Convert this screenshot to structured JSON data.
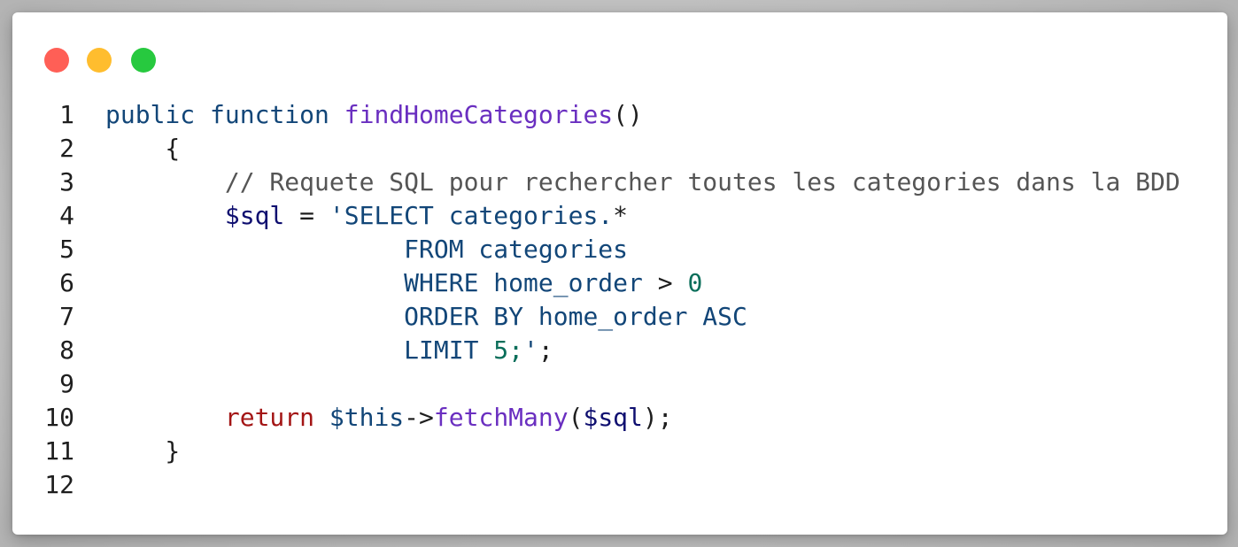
{
  "window": {
    "controls": {
      "close_color": "#ff5f56",
      "minimize_color": "#ffbd2e",
      "maximize_color": "#27c93f"
    }
  },
  "code": {
    "line_numbers": [
      "1",
      "2",
      "3",
      "4",
      "5",
      "6",
      "7",
      "8",
      "9",
      "10",
      "11",
      "12"
    ],
    "lines": [
      {
        "tokens": [
          {
            "t": "public",
            "c": "kw"
          },
          {
            "t": " ",
            "c": "op"
          },
          {
            "t": "function",
            "c": "kw"
          },
          {
            "t": " ",
            "c": "op"
          },
          {
            "t": "findHomeCategories",
            "c": "fn"
          },
          {
            "t": "()",
            "c": "op"
          }
        ]
      },
      {
        "tokens": [
          {
            "t": "    {",
            "c": "op"
          }
        ]
      },
      {
        "tokens": [
          {
            "t": "        // Requete SQL pour rechercher toutes les categories dans la BDD",
            "c": "cmt"
          }
        ]
      },
      {
        "tokens": [
          {
            "t": "        ",
            "c": "op"
          },
          {
            "t": "$sql",
            "c": "var"
          },
          {
            "t": " = ",
            "c": "op"
          },
          {
            "t": "'SELECT categories.",
            "c": "str"
          },
          {
            "t": "*",
            "c": "op"
          }
        ]
      },
      {
        "tokens": [
          {
            "t": "                    FROM categories",
            "c": "str"
          }
        ]
      },
      {
        "tokens": [
          {
            "t": "                    WHERE home_order ",
            "c": "str"
          },
          {
            "t": ">",
            "c": "op"
          },
          {
            "t": " ",
            "c": "op"
          },
          {
            "t": "0",
            "c": "num"
          }
        ]
      },
      {
        "tokens": [
          {
            "t": "                    ORDER BY home_order ASC",
            "c": "str"
          }
        ]
      },
      {
        "tokens": [
          {
            "t": "                    LIMIT ",
            "c": "str"
          },
          {
            "t": "5;",
            "c": "num"
          },
          {
            "t": "'",
            "c": "str"
          },
          {
            "t": ";",
            "c": "op"
          }
        ]
      },
      {
        "tokens": []
      },
      {
        "tokens": [
          {
            "t": "        ",
            "c": "op"
          },
          {
            "t": "return",
            "c": "ret"
          },
          {
            "t": " ",
            "c": "op"
          },
          {
            "t": "$this",
            "c": "kw"
          },
          {
            "t": "->",
            "c": "op"
          },
          {
            "t": "fetchMany",
            "c": "fn"
          },
          {
            "t": "(",
            "c": "op"
          },
          {
            "t": "$sql",
            "c": "var"
          },
          {
            "t": ");",
            "c": "op"
          }
        ]
      },
      {
        "tokens": [
          {
            "t": "    }",
            "c": "op"
          }
        ]
      },
      {
        "tokens": []
      }
    ]
  }
}
